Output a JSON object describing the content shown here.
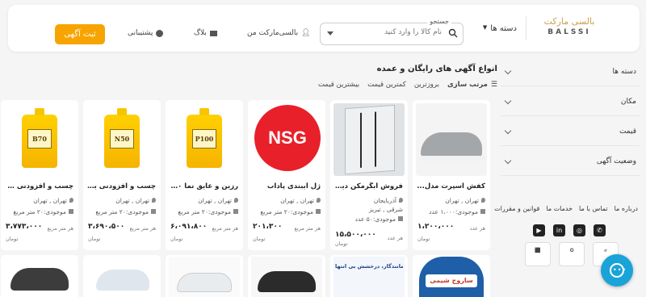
{
  "header": {
    "logo_fa": "بالسی مارکت",
    "logo_en": "BALSSI",
    "categories_label": "دسته ها",
    "search_label": "جستجو",
    "search_placeholder": "نام کالا را وارد کنید",
    "nav_account": "بالسی‌مارکت من",
    "nav_blog": "بلاگ",
    "nav_support": "پشتیبانی",
    "post_ad_button": "ثبت آگهی"
  },
  "sidebar": {
    "filters": [
      "دسته ها",
      "مکان",
      "قیمت",
      "وضعیت آگهی"
    ],
    "footer_links": [
      "درباره ما",
      "تماس با ما",
      "خدمات ما",
      "قوانین و مقررات"
    ],
    "social_icons": [
      "whatsapp-icon",
      "instagram-icon",
      "linkedin-icon",
      "youtube-icon"
    ]
  },
  "main": {
    "title": "انواع آگهی های رایگان و عمده",
    "sort_label": "مرتب سازی",
    "sort_options": [
      "بروزترین",
      "کمترین قیمت",
      "بیشترین قیمت"
    ]
  },
  "products": [
    {
      "title": "کفش اسپرت مدل...",
      "city": "تهران , تهران",
      "stock": "موجودی:۱،۰۰۰ عدد",
      "unit": "هر عدد",
      "price": "۱،۲۰۰،۰۰۰",
      "currency": "تومان"
    },
    {
      "title": "فروش آبگرمکن دیوار...",
      "city": "آذربایجان",
      "city2": "شرقی , تبریز",
      "stock": "موجودی:۵۰ عدد",
      "unit": "هر عدد",
      "price": "۱۵،۵۰۰،۰۰۰",
      "currency": "تومان"
    },
    {
      "title": "ژل آببندی پاداب",
      "city": "تهران , تهران",
      "stock": "موجودی:۲۰ متر مربع",
      "unit": "هر متر مربع",
      "price": "۲۰۱،۳۰۰",
      "currency": "تومان",
      "brand": "NSG"
    },
    {
      "title": "رزین و عایق نما p۱۰۰",
      "city": "تهران , تهران",
      "stock": "موجودی:۲۰ متر مربع",
      "unit": "هر متر مربع",
      "price": "۶،۰۹۱،۸۰۰",
      "currency": "تومان",
      "label": "P100"
    },
    {
      "title": "چسب و افزودنی بتن...",
      "city": "تهران , تهران",
      "stock": "موجودی:۲۰ متر مربع",
      "unit": "هر متر مربع",
      "price": "۳،۶۹۰،۵۰۰",
      "currency": "تومان",
      "label": "N50"
    },
    {
      "title": "چسب و افزودنی ملا...",
      "city": "تهران , تهران",
      "stock": "موجودی:۲۰ متر مربع",
      "unit": "هر متر مربع",
      "price": "۳،۷۷۳،۰۰۰",
      "currency": "تومان",
      "label": "B70"
    }
  ],
  "second_row": {
    "banner2": "تمیزی مانندگار، درخشش بی انتها",
    "banner1": "ساروج شیمی"
  },
  "colors": {
    "accent": "#f7a400",
    "chat": "#1aa3d8",
    "brand_red": "#e8202a"
  }
}
